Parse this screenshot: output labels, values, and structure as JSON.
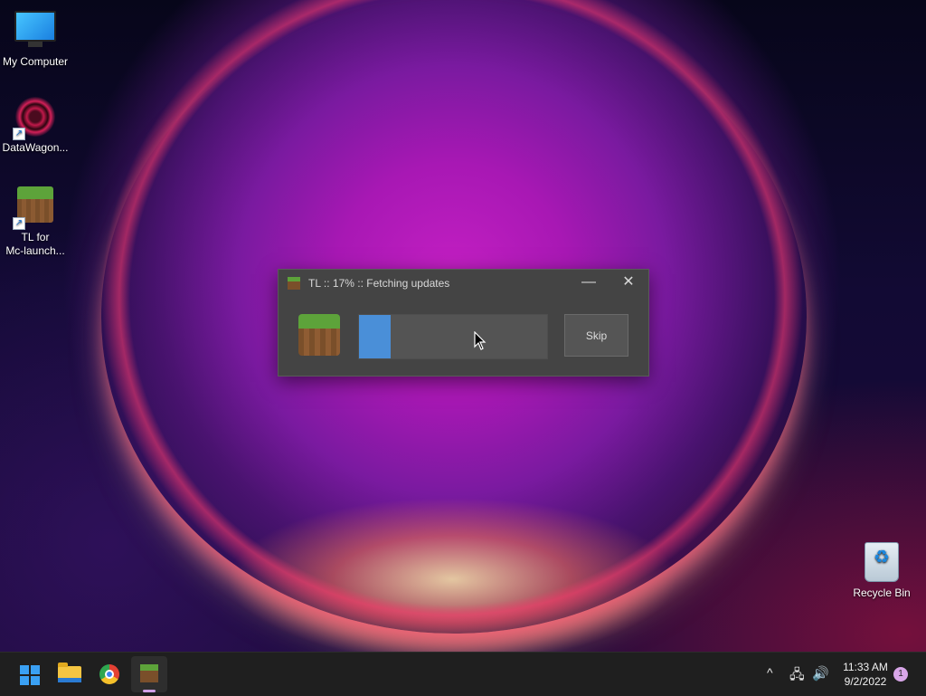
{
  "desktop": {
    "icons": [
      {
        "label": "My Computer"
      },
      {
        "label": "DataWagon..."
      },
      {
        "label": "TL for\nMc-launch..."
      },
      {
        "label": "Recycle Bin"
      }
    ]
  },
  "dialog": {
    "title": "TL :: 17% :: Fetching updates",
    "progress_percent": 17,
    "skip_label": "Skip",
    "minimize_glyph": "—",
    "close_glyph": "✕"
  },
  "taskbar": {
    "time": "11:33 AM",
    "date": "9/2/2022",
    "notification_count": "1",
    "tray_chevron": "^"
  },
  "colors": {
    "accent": "#4a8fd8",
    "dialog_bg": "#444444",
    "taskbar_bg": "#1f1f1f"
  }
}
